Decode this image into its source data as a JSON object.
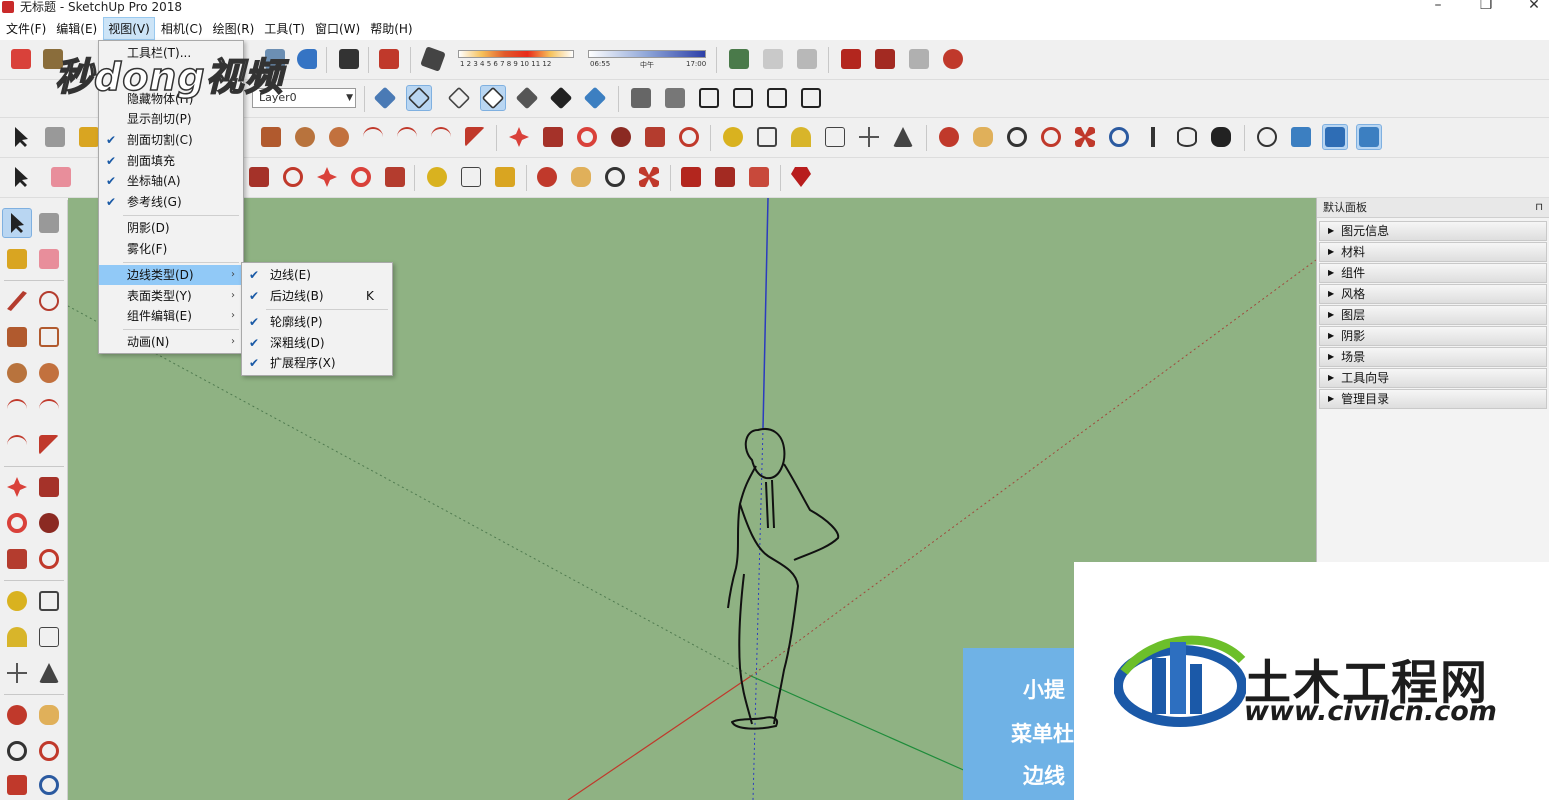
{
  "window": {
    "title": "无标题 - SketchUp Pro 2018",
    "minimize": "–",
    "restore": "❐",
    "close": "✕"
  },
  "menubar": [
    {
      "label": "文件(F)"
    },
    {
      "label": "编辑(E)"
    },
    {
      "label": "视图(V)",
      "active": true
    },
    {
      "label": "相机(C)"
    },
    {
      "label": "绘图(R)"
    },
    {
      "label": "工具(T)"
    },
    {
      "label": "窗口(W)"
    },
    {
      "label": "帮助(H)"
    }
  ],
  "shadow_bar": {
    "months": "1 2 3 4 5 6 7 8 9 10 11 12",
    "time_start": "06:55",
    "time_mid": "中午",
    "time_end": "17:00"
  },
  "layer_combo": {
    "value": "Layer0"
  },
  "view_menu": {
    "items": [
      {
        "label": "工具栏(T)...",
        "checked": false
      },
      {
        "label": "隐藏物体(H)",
        "checked": false
      },
      {
        "label": "显示剖切(P)",
        "checked": false
      },
      {
        "label": "剖面切割(C)",
        "checked": true
      },
      {
        "label": "剖面填充",
        "checked": true
      },
      {
        "label": "坐标轴(A)",
        "checked": true
      },
      {
        "label": "参考线(G)",
        "checked": true
      },
      {
        "label": "阴影(D)",
        "checked": false
      },
      {
        "label": "雾化(F)",
        "checked": false
      },
      {
        "label": "边线类型(D)",
        "checked": false,
        "submenu": true,
        "highlight": true
      },
      {
        "label": "表面类型(Y)",
        "checked": false,
        "submenu": true
      },
      {
        "label": "组件编辑(E)",
        "checked": false,
        "submenu": true
      },
      {
        "label": "动画(N)",
        "checked": false,
        "submenu": true
      }
    ]
  },
  "edge_submenu": {
    "items": [
      {
        "label": "边线(E)",
        "checked": true,
        "shortcut": ""
      },
      {
        "label": "后边线(B)",
        "checked": true,
        "shortcut": "K"
      },
      {
        "label": "轮廓线(P)",
        "checked": true,
        "shortcut": ""
      },
      {
        "label": "深粗线(D)",
        "checked": true,
        "shortcut": ""
      },
      {
        "label": "扩展程序(X)",
        "checked": true,
        "shortcut": ""
      }
    ]
  },
  "panel": {
    "title": "默认面板",
    "pin": "⊓",
    "trays": [
      "图元信息",
      "材料",
      "组件",
      "风格",
      "图层",
      "阴影",
      "场景",
      "工具向导",
      "管理目录"
    ]
  },
  "overlay": {
    "watermark": "秒dong视频",
    "tip_lines": [
      "小提",
      "菜单杜",
      "边线"
    ],
    "logo_name": "土木工程网",
    "logo_url": "www.civilcn.com"
  },
  "colors": {
    "viewport": "#8fb283",
    "axis_blue": "#2b3bbf",
    "axis_red": "#c0392b",
    "axis_green": "#1e8c3a",
    "menu_highlight": "#91c9f7",
    "tip_bg": "#6fb2e6"
  }
}
